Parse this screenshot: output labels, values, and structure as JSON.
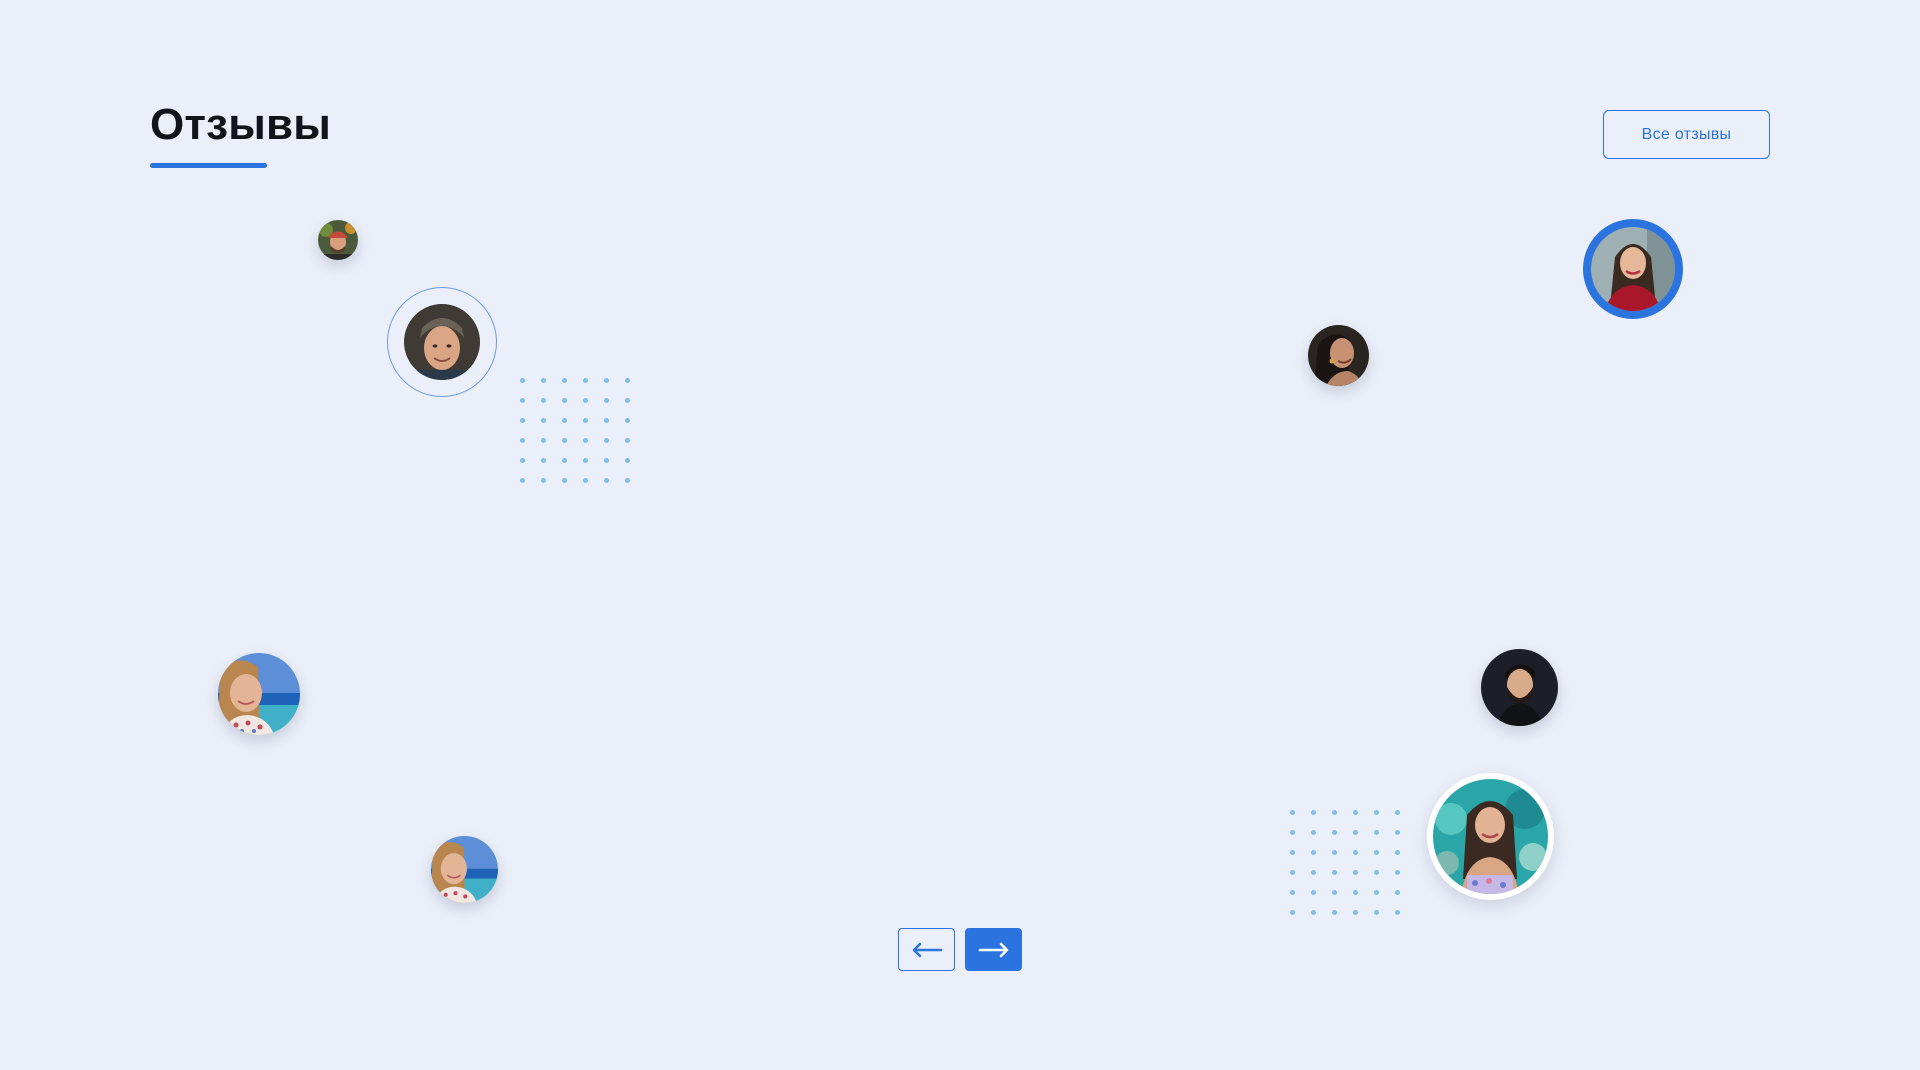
{
  "section": {
    "title": "Отзывы",
    "all_reviews_label": "Все отзывы"
  },
  "carousel": {
    "prev_icon": "arrow-left-icon",
    "next_icon": "arrow-right-icon"
  },
  "avatars": [
    "avatar-man-cap",
    "avatar-man-beanie",
    "avatar-woman-red-top",
    "avatar-woman-profile",
    "avatar-woman-seaside-large",
    "avatar-woman-seaside-small",
    "avatar-man-beard",
    "avatar-woman-teal-background"
  ],
  "colors": {
    "accent": "#2b74e0",
    "background": "#ebeff9",
    "dot": "#7fbfe8",
    "title": "#111418"
  }
}
